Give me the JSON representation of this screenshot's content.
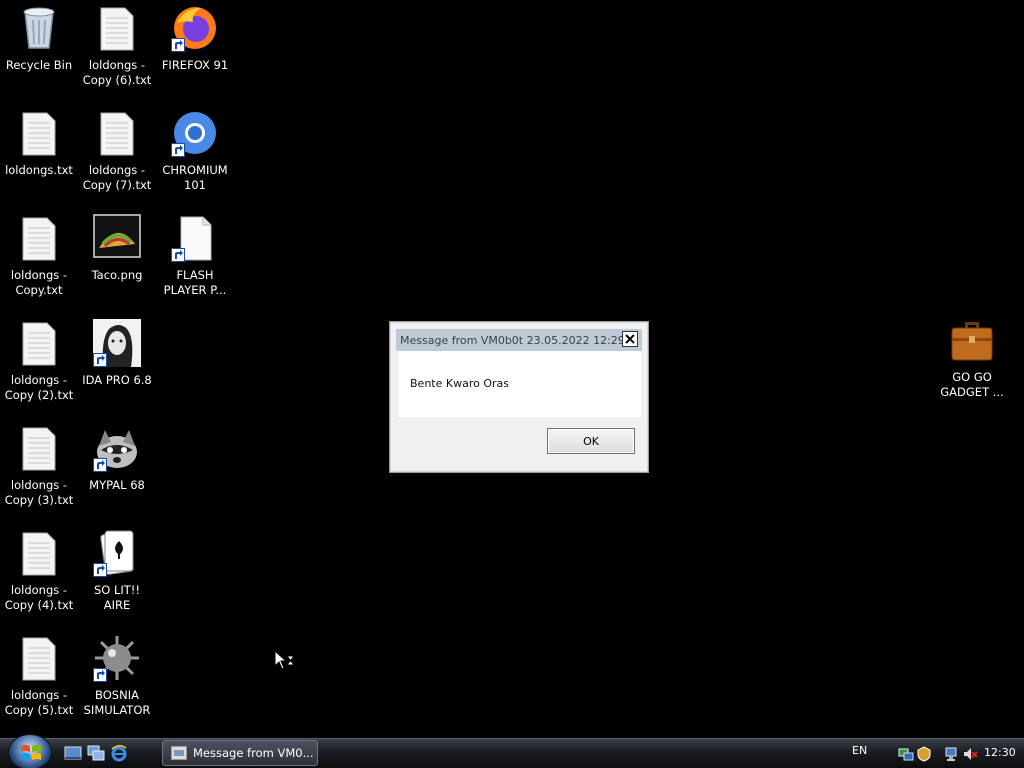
{
  "desktop": {
    "icons": [
      {
        "label": "Recycle Bin",
        "icon": "recycle-bin-icon"
      },
      {
        "label": "loldongs -\nCopy (6).txt",
        "icon": "text-file-icon"
      },
      {
        "label": "FIREFOX 91",
        "icon": "firefox-icon"
      },
      {
        "label": "loldongs.txt",
        "icon": "text-file-icon"
      },
      {
        "label": "loldongs -\nCopy (7).txt",
        "icon": "text-file-icon"
      },
      {
        "label": "CHROMIUM\n101",
        "icon": "chromium-icon"
      },
      {
        "label": "loldongs -\nCopy.txt",
        "icon": "text-file-icon"
      },
      {
        "label": "Taco.png",
        "icon": "image-file-icon"
      },
      {
        "label": "FLASH\nPLAYER P...",
        "icon": "file-shortcut-icon"
      },
      {
        "label": "loldongs -\nCopy (2).txt",
        "icon": "text-file-icon"
      },
      {
        "label": "IDA PRO 6.8",
        "icon": "ida-pro-icon"
      },
      {
        "label": "loldongs -\nCopy (3).txt",
        "icon": "text-file-icon"
      },
      {
        "label": "MYPAL 68",
        "icon": "mypal-icon"
      },
      {
        "label": "loldongs -\nCopy (4).txt",
        "icon": "text-file-icon"
      },
      {
        "label": "SO LIT!! AIRE",
        "icon": "solitaire-icon"
      },
      {
        "label": "loldongs -\nCopy (5).txt",
        "icon": "text-file-icon"
      },
      {
        "label": "BOSNIA\nSIMULATOR",
        "icon": "minesweeper-icon"
      },
      {
        "label": "GO GO\nGADGET ...",
        "icon": "briefcase-icon"
      }
    ]
  },
  "dialog": {
    "title": "Message from VM0b0t 23.05.2022 12:29",
    "message": "Bente Kwaro Oras",
    "ok_label": "OK"
  },
  "taskbar": {
    "active_window_label": "Message from VM0...",
    "language": "EN",
    "clock": "12:30"
  }
}
